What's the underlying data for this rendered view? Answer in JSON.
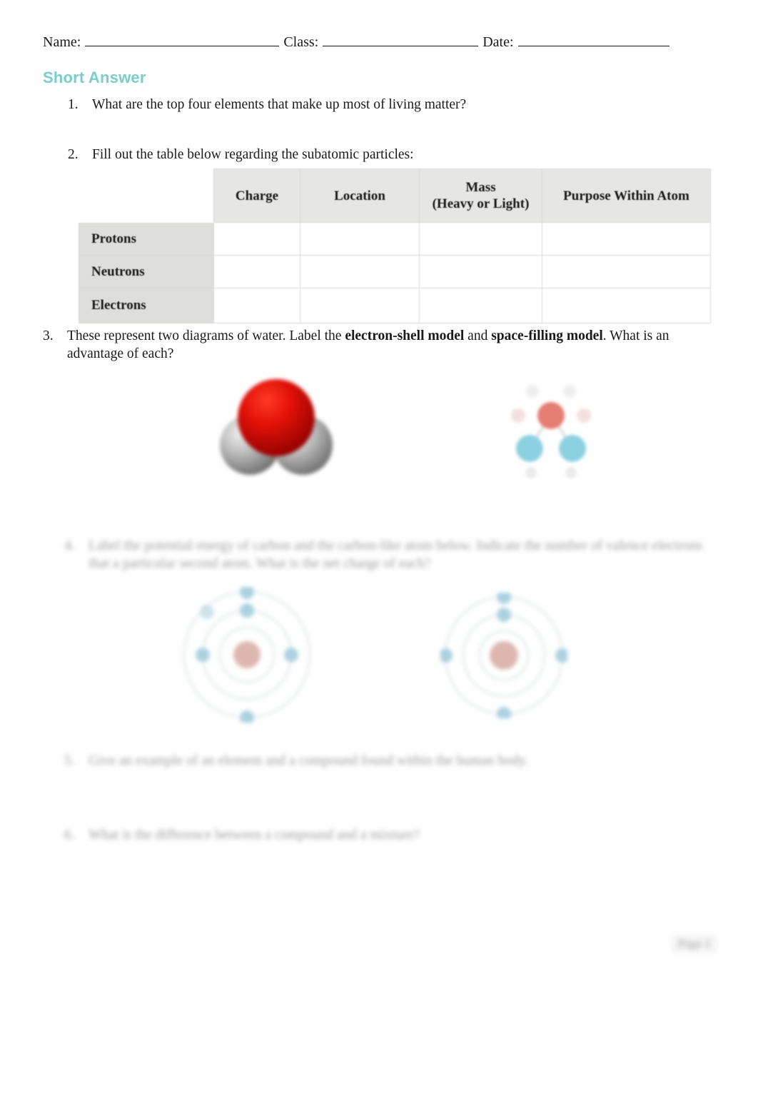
{
  "header": {
    "name_label": "Name:",
    "class_label": "Class:",
    "date_label": "Date:",
    "name_value": "",
    "class_value": "",
    "date_value": ""
  },
  "section": {
    "title": "Short Answer",
    "accent_color": "#79cdcd"
  },
  "questions": [
    {
      "number": "1.",
      "text": "What are the top four elements that make up most of living matter?",
      "legible": true
    },
    {
      "number": "2.",
      "text": "Fill out the table below regarding the subatomic particles:",
      "legible": true
    },
    {
      "number": "3.",
      "text_before": "These represent two diagrams of water.  Label the ",
      "bold_1": "electron-shell model",
      "text_middle": " and ",
      "bold_2": "space-filling model",
      "text_after": ".  What is an advantage of each?",
      "legible": true
    },
    {
      "number": "4.",
      "text": "Label the potential energy of carbon and the carbon-like atom below.  Indicate the number of valence electrons that a particular second atom.  What is the net charge of each?",
      "legible": false
    },
    {
      "number": "5.",
      "text": "Give an example of an element and a compound found within the human body.",
      "legible": false
    },
    {
      "number": "6.",
      "text": "What is the difference between a compound and a mixture?",
      "legible": false
    }
  ],
  "table": {
    "corner_label": "",
    "column_headers": [
      "Charge",
      "Location",
      "Mass\n(Heavy or Light)",
      "Purpose Within Atom"
    ],
    "column_header_mass_line1": "Mass",
    "column_header_mass_line2": "(Heavy or Light)",
    "row_labels": [
      "Protons",
      "Neutrons",
      "Electrons"
    ],
    "cells": [
      [
        "",
        "",
        "",
        ""
      ],
      [
        "",
        "",
        "",
        ""
      ],
      [
        "",
        "",
        "",
        ""
      ]
    ],
    "header_bg": "#e6e6e4",
    "row_label_bg": "#dededc",
    "border_color": "#d9d9d9"
  },
  "figures": {
    "q3": [
      {
        "name": "space-filling-model-of-water",
        "description": "Space-filling model of a water molecule: large red oxygen sphere with two gray hydrogen spheres",
        "colors": {
          "oxygen": "#cc0c0c",
          "hydrogen": "#9a9a9a"
        }
      },
      {
        "name": "electron-shell-model-of-water",
        "description": "Electron-shell model of a water molecule: red oxygen circle with two cyan hydrogen circles",
        "colors": {
          "oxygen": "#e07a72",
          "hydrogen": "#7bc9d6"
        }
      }
    ],
    "q4": [
      {
        "name": "bohr-model-atom-left",
        "description": "Bohr shell diagram: reddish nucleus with concentric electron shells and blue electrons",
        "colors": {
          "nucleus": "#c98b80",
          "electron": "#79b6cc",
          "shell": "#e2e6e8"
        }
      },
      {
        "name": "bohr-model-atom-right",
        "description": "Bohr shell diagram: reddish nucleus with concentric electron shells and blue electrons",
        "colors": {
          "nucleus": "#c98b80",
          "electron": "#79b6cc",
          "shell": "#e2e6e8"
        }
      }
    ]
  },
  "footer": {
    "page_marker": "Page 1"
  }
}
